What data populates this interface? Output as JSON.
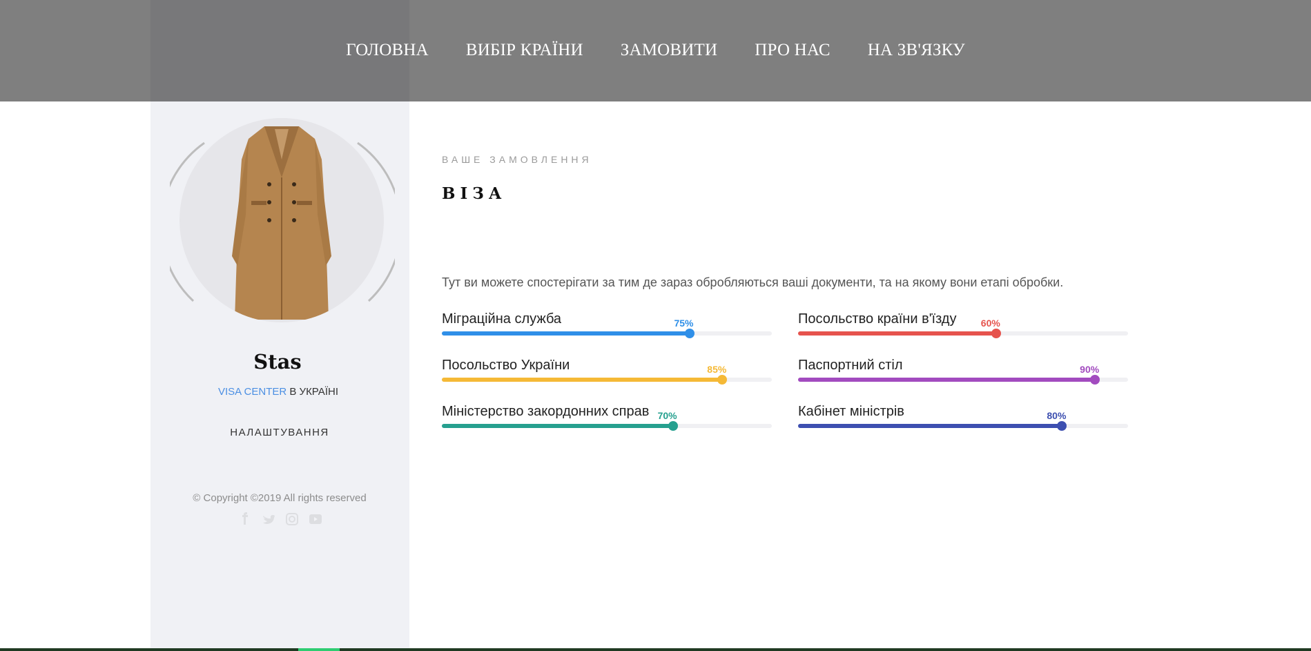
{
  "nav": {
    "items": [
      "ГОЛОВНА",
      "ВИБІР КРАЇНИ",
      "ЗАМОВИТИ",
      "ПРО НАС",
      "НА ЗВ'ЯЗКУ"
    ]
  },
  "profile": {
    "name": "Stas",
    "brand": "VISA CENTER",
    "location": " В УКРАЇНІ",
    "settings": "НАЛАШТУВАННЯ",
    "copyright": "© Copyright ©2019 All rights reserved",
    "avatar_icon": "coat-image"
  },
  "order": {
    "eyebrow": "ВАШЕ ЗАМОВЛЕННЯ",
    "title": "ВІЗА",
    "intro": "Тут ви можете спостерігати за тим де зараз обробляються ваші документи, та на якому вони етапі обробки."
  },
  "progress": [
    {
      "label": "Міграційна служба",
      "percent": 75,
      "percent_label": "75%",
      "color": "#2f8fe8"
    },
    {
      "label": "Посольство країни в'їзду",
      "percent": 60,
      "percent_label": "60%",
      "color": "#e6534d"
    },
    {
      "label": "Посольство України",
      "percent": 85,
      "percent_label": "85%",
      "color": "#f5b936"
    },
    {
      "label": "Паспортний стіл",
      "percent": 90,
      "percent_label": "90%",
      "color": "#a24bbf"
    },
    {
      "label": "Міністерство закордонних справ",
      "percent": 70,
      "percent_label": "70%",
      "color": "#26a08f"
    },
    {
      "label": "Кабінет міністрів",
      "percent": 80,
      "percent_label": "80%",
      "color": "#3d4fb0"
    }
  ],
  "socials": [
    "facebook-icon",
    "twitter-icon",
    "instagram-icon",
    "youtube-icon"
  ]
}
